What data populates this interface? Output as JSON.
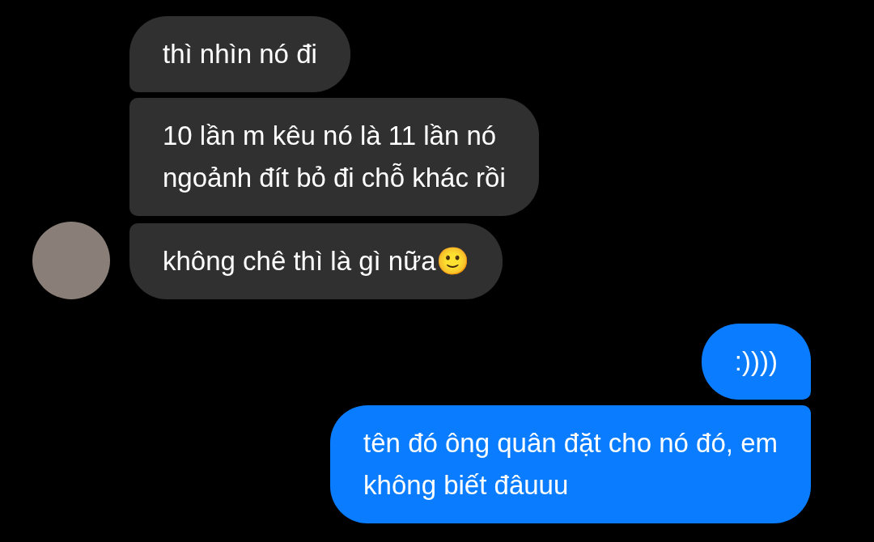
{
  "messages": [
    {
      "kind": "received",
      "text": "thì nhìn nó đi",
      "avatar": false
    },
    {
      "kind": "received",
      "text": "10 lần m kêu nó là 11 lần nó\nngoảnh đít bỏ đi chỗ khác rồi",
      "avatar": false
    },
    {
      "kind": "received",
      "text": "không chê thì là gì nữa🙂",
      "avatar": true
    },
    {
      "kind": "sent",
      "text": ":))))",
      "avatar": false
    },
    {
      "kind": "sent",
      "text": "tên đó ông quân đặt cho nó đó, em\nkhông biết đâuuu",
      "avatar": false
    }
  ]
}
